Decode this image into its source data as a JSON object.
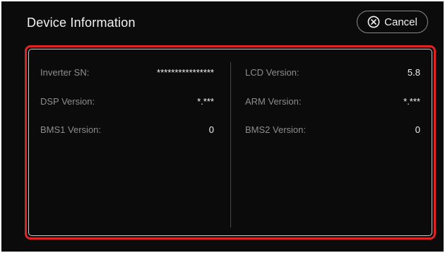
{
  "header": {
    "title": "Device Information",
    "cancel_label": "Cancel"
  },
  "icons": {
    "cancel": "close-circle-icon"
  },
  "colors": {
    "background": "#0b0b0b",
    "highlight_border": "#e02424",
    "label_text": "#8d8d8d",
    "value_text": "#f2f2f2"
  },
  "left_column": [
    {
      "label": "Inverter SN:",
      "value": "****************"
    },
    {
      "label": "DSP Version:",
      "value": "*.***"
    },
    {
      "label": "BMS1 Version:",
      "value": "0"
    }
  ],
  "right_column": [
    {
      "label": "LCD Version:",
      "value": "5.8"
    },
    {
      "label": "ARM Version:",
      "value": "*.***"
    },
    {
      "label": "BMS2 Version:",
      "value": "0"
    }
  ]
}
